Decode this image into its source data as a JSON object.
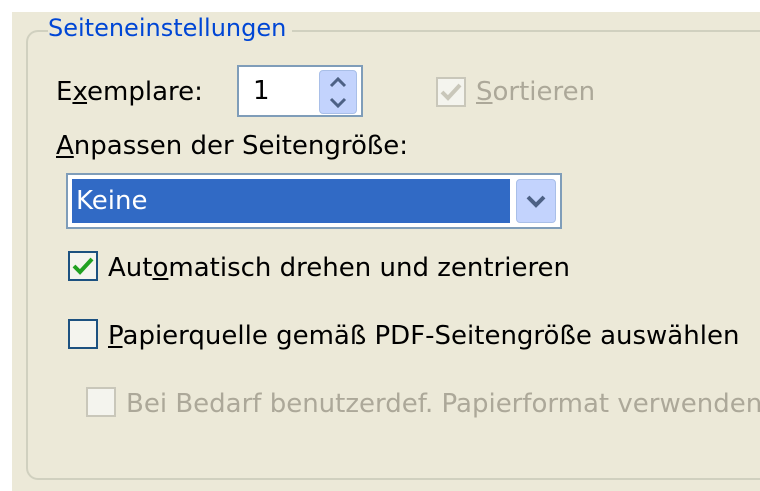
{
  "group": {
    "title": "Seiteneinstellungen"
  },
  "copies": {
    "label_pre": "E",
    "label_u": "x",
    "label_post": "emplare:",
    "value": "1"
  },
  "collate": {
    "label_u": "S",
    "label_post": "ortieren",
    "checked": true,
    "enabled": false
  },
  "page_scaling": {
    "label_u": "A",
    "label_post": "npassen der Seitengröße:",
    "selected": "Keine"
  },
  "auto_rotate": {
    "label_pre": "Aut",
    "label_u": "o",
    "label_post": "matisch drehen und zentrieren",
    "checked": true
  },
  "paper_source": {
    "label_u": "P",
    "label_post": "apierquelle gemäß PDF-Seitengröße auswählen",
    "checked": false
  },
  "custom_paper": {
    "label": "Bei Bedarf benutzerdef. Papierformat verwenden",
    "checked": false,
    "enabled": false
  },
  "colors": {
    "accent": "#0046d5",
    "selection": "#316ac5",
    "check": "#21a121"
  }
}
